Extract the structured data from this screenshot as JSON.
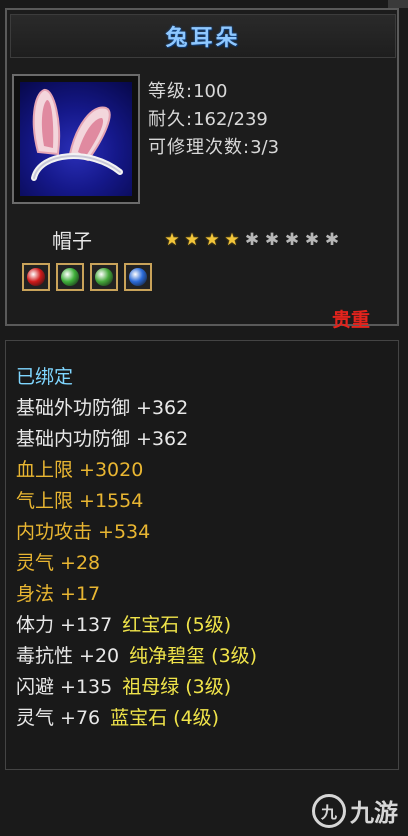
{
  "item": {
    "name": "兔耳朵",
    "level_label": "等级:",
    "level_value": "100",
    "durability_label": "耐久:",
    "durability_value": "162/239",
    "repair_label": "可修理次数:",
    "repair_value": "3/3",
    "type": "帽子",
    "stars_filled": 4,
    "stars_total": 9,
    "rarity": "贵重",
    "bound": "已绑定"
  },
  "gems": [
    {
      "icon": "red-gem-icon",
      "color": "#d11a1a"
    },
    {
      "icon": "green-gem-icon",
      "color": "#3fb03a"
    },
    {
      "icon": "green-gem-icon",
      "color": "#45a83a"
    },
    {
      "icon": "blue-gem-icon",
      "color": "#2a6ad8"
    }
  ],
  "attributes": [
    {
      "text": "基础外功防御 +362",
      "color": "#e8e8e8"
    },
    {
      "text": "基础内功防御 +362",
      "color": "#e8e8e8"
    },
    {
      "text": "血上限 +3020",
      "color": "#e9b632"
    },
    {
      "text": "气上限 +1554",
      "color": "#e9b632"
    },
    {
      "text": "内功攻击 +534",
      "color": "#e9b632"
    },
    {
      "text": "灵气 +28",
      "color": "#e9b632"
    },
    {
      "text": "身法 +17",
      "color": "#e9b632"
    },
    {
      "text": "体力 +137",
      "gem": "红宝石 (5级)",
      "color": "#e8e8e8",
      "gem_color": "#f0e44a"
    },
    {
      "text": "毒抗性 +20",
      "gem": "纯净碧玺 (3级)",
      "color": "#e8e8e8",
      "gem_color": "#f0e44a"
    },
    {
      "text": "闪避 +135",
      "gem": "祖母绿 (3级)",
      "color": "#e8e8e8",
      "gem_color": "#f0e44a"
    },
    {
      "text": "灵气 +76",
      "gem": "蓝宝石 (4级)",
      "color": "#e8e8e8",
      "gem_color": "#f0e44a"
    }
  ],
  "watermark": {
    "logo": "九",
    "text": "九游"
  }
}
